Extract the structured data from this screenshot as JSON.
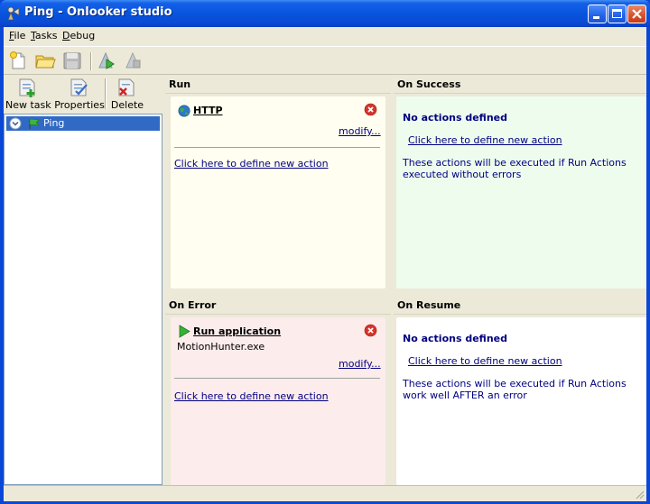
{
  "window": {
    "title": "Ping - Onlooker studio"
  },
  "menu": [
    {
      "label": "File",
      "mnemonic": "F",
      "rest": "ile"
    },
    {
      "label": "Tasks",
      "mnemonic": "T",
      "rest": "asks"
    },
    {
      "label": "Debug",
      "mnemonic": "D",
      "rest": "ebug"
    }
  ],
  "toolbar": {
    "icons": [
      "new-document-icon",
      "open-folder-icon",
      "save-disk-icon",
      "run-green-icon",
      "stop-gray-icon"
    ]
  },
  "task_toolbar": {
    "new_task": "New task",
    "properties": "Properties",
    "delete": "Delete"
  },
  "tree": {
    "items": [
      {
        "label": "Ping",
        "selected": true
      }
    ]
  },
  "panels": {
    "run": {
      "title": "Run",
      "action_name": "HTTP",
      "modify": "modify...",
      "define_link": "Click here to define new action",
      "bg": "#fffef0"
    },
    "on_success": {
      "title": "On Success",
      "no_actions": "No actions defined",
      "define_link": "Click here to define new action",
      "description": "These actions will be executed if Run Actions executed without errors",
      "bg": "#eefcee"
    },
    "on_error": {
      "title": "On Error",
      "action_name": "Run application",
      "action_detail": "MotionHunter.exe",
      "modify": "modify...",
      "define_link": "Click here to define new action",
      "bg": "#fcecec"
    },
    "on_resume": {
      "title": "On Resume",
      "no_actions": "No actions defined",
      "define_link": "Click here to define new action",
      "description": "These actions will be executed if Run Actions work well AFTER an error",
      "bg": "#ffffff"
    }
  },
  "colors": {
    "titlebar": "#0855dd",
    "selection": "#316ac5",
    "link": "#000080",
    "chrome": "#ece9d8"
  }
}
